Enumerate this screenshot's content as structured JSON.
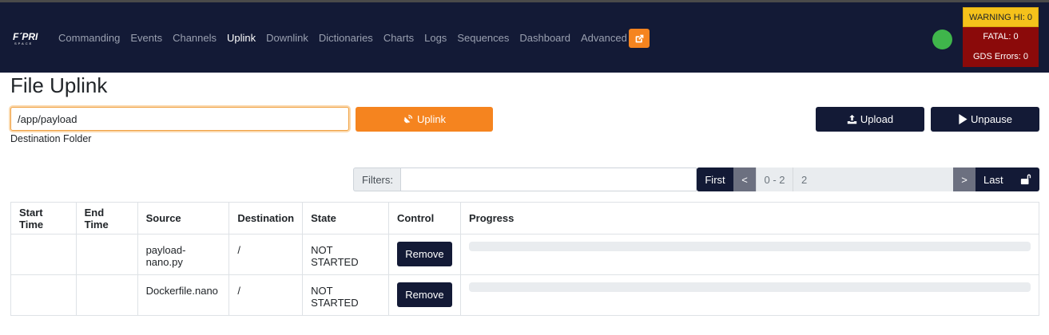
{
  "brand": {
    "logo_main": "F´PRI",
    "logo_sub": "SPACE"
  },
  "nav": {
    "items": [
      {
        "label": "Commanding"
      },
      {
        "label": "Events"
      },
      {
        "label": "Channels"
      },
      {
        "label": "Uplink"
      },
      {
        "label": "Downlink"
      },
      {
        "label": "Dictionaries"
      },
      {
        "label": "Charts"
      },
      {
        "label": "Logs"
      },
      {
        "label": "Sequences"
      },
      {
        "label": "Dashboard"
      },
      {
        "label": "Advanced"
      }
    ],
    "active": "Uplink",
    "external_icon": "external-link-icon"
  },
  "status": {
    "indicator_color": "#3fb54b",
    "warning": "WARNING HI: 0",
    "fatal": "FATAL: 0",
    "gds_errors": "GDS Errors: 0"
  },
  "page": {
    "title": "File Uplink"
  },
  "form": {
    "destination_value": "/app/payload",
    "destination_label": "Destination Folder",
    "uplink_label": "Uplink",
    "upload_label": "Upload",
    "unpause_label": "Unpause"
  },
  "filter": {
    "label": "Filters:",
    "value": ""
  },
  "pagination": {
    "first": "First",
    "prev": "<",
    "range": "0 - 2",
    "page": "2",
    "next": ">",
    "last": "Last"
  },
  "table": {
    "headers": [
      "Start Time",
      "End Time",
      "Source",
      "Destination",
      "State",
      "Control",
      "Progress"
    ],
    "rows": [
      {
        "start_time": "",
        "end_time": "",
        "source": "payload-nano.py",
        "destination": "/",
        "state": "NOT STARTED",
        "control": "Remove",
        "progress": 0
      },
      {
        "start_time": "",
        "end_time": "",
        "source": "Dockerfile.nano",
        "destination": "/",
        "state": "NOT STARTED",
        "control": "Remove",
        "progress": 0
      }
    ]
  },
  "colors": {
    "navbar": "#131a36",
    "accent": "#f5841f",
    "warning": "#f5c21b",
    "fatal": "#8b0a0a"
  }
}
